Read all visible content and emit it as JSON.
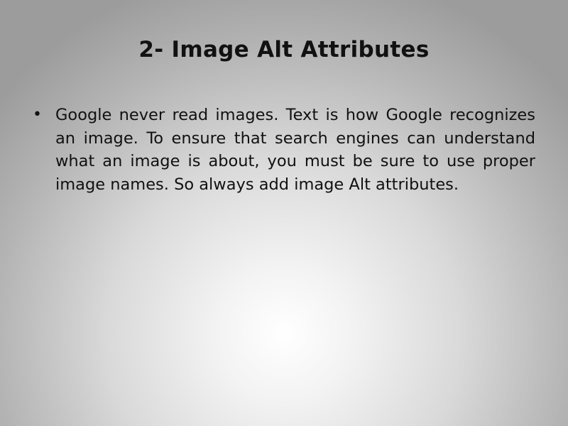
{
  "slide": {
    "title": "2- Image Alt Attributes",
    "bullets": [
      {
        "marker": "•",
        "text": "Google never read images.  Text is how Google recognizes an image. To ensure that search engines can understand what an image is about, you must be sure to use proper image names. So always add image Alt attributes."
      }
    ]
  }
}
